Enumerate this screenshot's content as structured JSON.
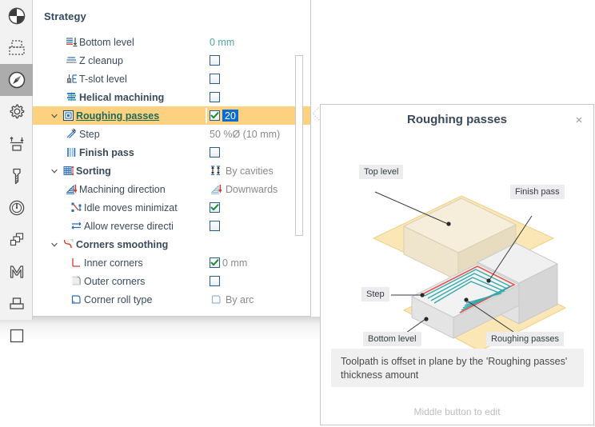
{
  "toolbar": {
    "items": [
      {
        "icon": "pie-quadrant-icon",
        "name": "tool-view-mode",
        "active": false
      },
      {
        "icon": "dashed-stock-icon",
        "name": "tool-stock",
        "active": false
      },
      {
        "icon": "compass-icon",
        "name": "tool-strategy",
        "active": true
      },
      {
        "icon": "gear-icon",
        "name": "tool-parameters",
        "active": false
      },
      {
        "icon": "levels-icon",
        "name": "tool-levels",
        "active": false
      },
      {
        "icon": "end-mill-icon",
        "name": "tool-tool",
        "active": false
      },
      {
        "icon": "speed-gauge-icon",
        "name": "tool-feeds-speeds",
        "active": false
      },
      {
        "icon": "layers-icon",
        "name": "tool-links",
        "active": false
      },
      {
        "icon": "letter-m-icon",
        "name": "tool-m-functions",
        "active": false
      },
      {
        "icon": "fixture-icon",
        "name": "tool-fixture",
        "active": false
      },
      {
        "icon": "square-icon",
        "name": "tool-misc",
        "active": false
      }
    ]
  },
  "panel": {
    "title": "Strategy",
    "rows": [
      {
        "indent": 1,
        "twisty": "",
        "icon": "bottom-level-icon",
        "label": "Bottom level",
        "bold": false,
        "selected": false,
        "value_type": "text",
        "value": "0 mm",
        "value_color": "teal"
      },
      {
        "indent": 1,
        "twisty": "",
        "icon": "z-cleanup-icon",
        "label": "Z cleanup",
        "bold": false,
        "selected": false,
        "value_type": "checkbox",
        "checked": false
      },
      {
        "indent": 1,
        "twisty": "",
        "icon": "t-slot-level-icon",
        "label": "T-slot level",
        "bold": false,
        "selected": false,
        "value_type": "checkbox",
        "checked": false
      },
      {
        "indent": 1,
        "twisty": "",
        "icon": "helical-machining-icon",
        "label": "Helical machining",
        "bold": true,
        "selected": false,
        "value_type": "checkbox",
        "checked": false
      },
      {
        "indent": 0,
        "twisty": "down",
        "icon": "roughing-passes-icon",
        "label": "Roughing passes",
        "bold": true,
        "selected": true,
        "value_type": "checkbox-edit",
        "checked": true,
        "value": "20"
      },
      {
        "indent": 1,
        "twisty": "",
        "icon": "step-icon",
        "label": "Step",
        "bold": false,
        "selected": false,
        "value_type": "text",
        "value": "50 %Ø (10 mm)",
        "value_color": "gray"
      },
      {
        "indent": 1,
        "twisty": "",
        "icon": "finish-pass-icon",
        "label": "Finish pass",
        "bold": true,
        "selected": false,
        "value_type": "checkbox",
        "checked": false
      },
      {
        "indent": 0,
        "twisty": "down",
        "icon": "sorting-icon",
        "label": "Sorting",
        "bold": true,
        "selected": false,
        "value_type": "icon-text",
        "value_icon": "by-cavities-icon",
        "value": "By cavities",
        "value_color": "gray"
      },
      {
        "indent": 1,
        "twisty": "",
        "icon": "machining-direction-icon",
        "label": "Machining direction",
        "bold": false,
        "selected": false,
        "value_type": "icon-text",
        "value_icon": "downwards-icon",
        "value": "Downwards",
        "value_color": "gray"
      },
      {
        "indent": 2,
        "twisty": "",
        "icon": "idle-moves-icon",
        "label": "Idle moves minimizat",
        "bold": false,
        "selected": false,
        "value_type": "checkbox",
        "checked": true
      },
      {
        "indent": 2,
        "twisty": "",
        "icon": "reverse-direction-icon",
        "label": "Allow reverse directi",
        "bold": false,
        "selected": false,
        "value_type": "checkbox",
        "checked": false
      },
      {
        "indent": 0,
        "twisty": "down",
        "icon": "corners-smoothing-icon",
        "label": "Corners smoothing",
        "bold": true,
        "selected": false,
        "value_type": "none"
      },
      {
        "indent": 2,
        "twisty": "",
        "icon": "inner-corners-icon",
        "label": "Inner corners",
        "bold": false,
        "selected": false,
        "value_type": "checkbox-text",
        "checked": true,
        "value": "0 mm",
        "value_color": "gray"
      },
      {
        "indent": 2,
        "twisty": "",
        "icon": "outer-corners-icon",
        "label": "Outer corners",
        "bold": false,
        "selected": false,
        "value_type": "checkbox",
        "checked": false
      },
      {
        "indent": 2,
        "twisty": "",
        "icon": "corner-roll-type-icon",
        "label": "Corner roll type",
        "bold": false,
        "selected": false,
        "value_type": "icon-text",
        "value_icon": "by-arc-icon",
        "value": "By arc",
        "value_color": "gray"
      }
    ]
  },
  "help": {
    "title": "Roughing passes",
    "close_label": "×",
    "note": "Toolpath is offset in plane by the 'Roughing passes' thickness amount",
    "hint": "Middle button to edit",
    "figure_labels": [
      {
        "text": "Top level",
        "name": "figure-label-top-level"
      },
      {
        "text": "Finish pass",
        "name": "figure-label-finish-pass"
      },
      {
        "text": "Step",
        "name": "figure-label-step"
      },
      {
        "text": "Bottom level",
        "name": "figure-label-bottom-level"
      },
      {
        "text": "Roughing passes",
        "name": "figure-label-roughing-passes"
      }
    ]
  },
  "colors": {
    "selection": "#fcd17f",
    "accent_blue": "#2a6db5",
    "edit_blue": "#0b6ccf",
    "teal_value": "#4aa8a0",
    "link_green": "#1d6b5a"
  }
}
